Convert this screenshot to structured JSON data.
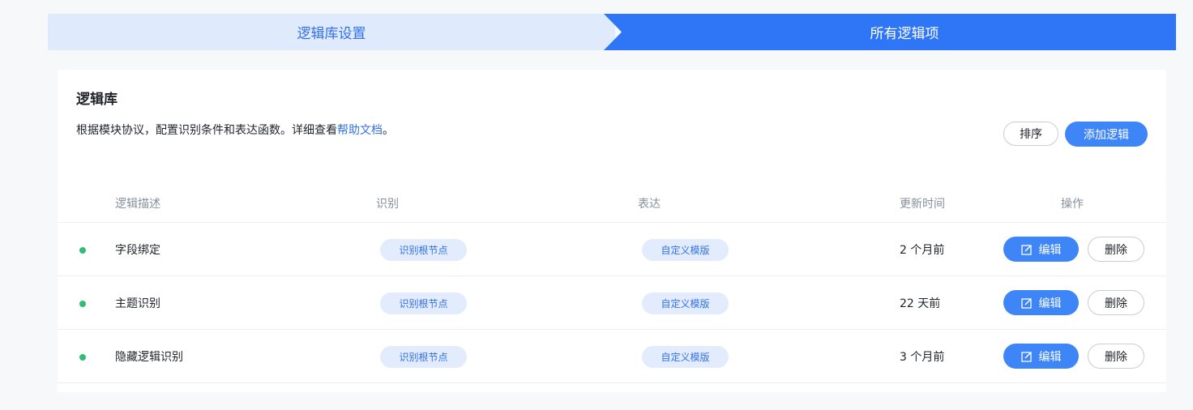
{
  "steps": {
    "step1": "逻辑库设置",
    "step2": "所有逻辑项"
  },
  "panel": {
    "title": "逻辑库",
    "description": "根据模块协议，配置识别条件和表达函数。详细查看",
    "help_link": "帮助文档",
    "description_end": "。",
    "sort_label": "排序",
    "add_label": "添加逻辑"
  },
  "table": {
    "headers": {
      "desc": "逻辑描述",
      "recognize": "识别",
      "express": "表达",
      "updated": "更新时间",
      "actions": "操作"
    },
    "rows": [
      {
        "name": "字段绑定",
        "recognize": "识别根节点",
        "express": "自定义模版",
        "updated": "2 个月前",
        "edit": "编辑",
        "delete": "删除"
      },
      {
        "name": "主题识别",
        "recognize": "识别根节点",
        "express": "自定义模版",
        "updated": "22 天前",
        "edit": "编辑",
        "delete": "删除"
      },
      {
        "name": "隐藏逻辑识别",
        "recognize": "识别根节点",
        "express": "自定义模版",
        "updated": "3 个月前",
        "edit": "编辑",
        "delete": "删除"
      }
    ]
  },
  "colors": {
    "primary": "#3e85f7",
    "status_dot": "#2fbd78",
    "tag_bg": "#e2ecfd"
  },
  "icons": {
    "edit": "edit-square-icon"
  }
}
